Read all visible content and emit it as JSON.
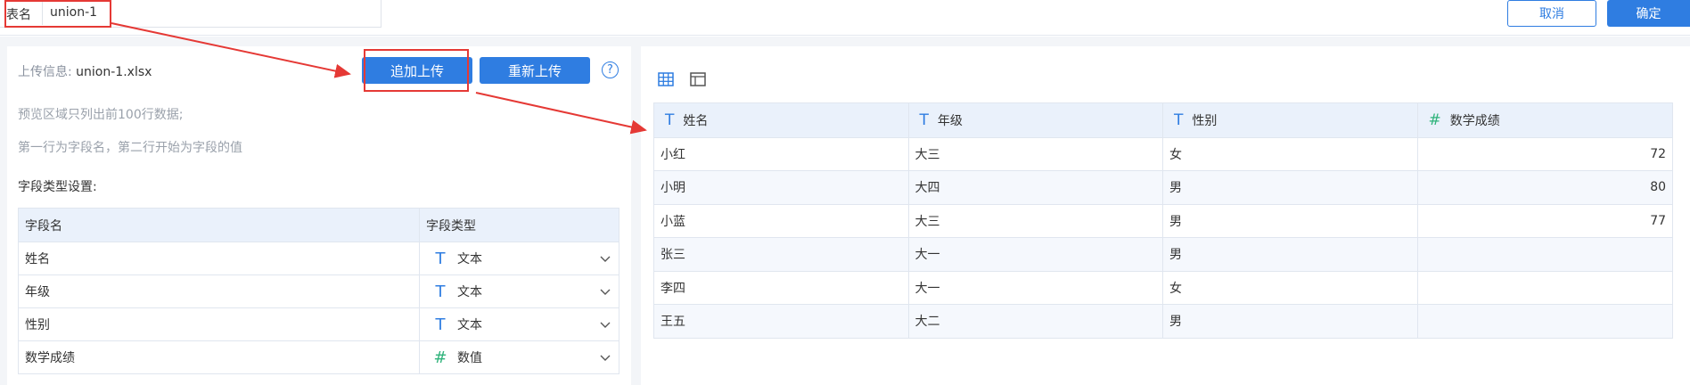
{
  "header": {
    "table_name_label": "表名",
    "table_name_value": "union-1",
    "cancel_label": "取消",
    "confirm_label": "确定"
  },
  "upload": {
    "info_label": "上传信息:",
    "file_name": "union-1.xlsx",
    "append_button": "追加上传",
    "reupload_button": "重新上传",
    "help_icon": "?",
    "hint_preview": "预览区域只列出前100行数据;",
    "hint_header": "第一行为字段名，第二行开始为字段的值"
  },
  "field_settings": {
    "title": "字段类型设置:",
    "col_name": "字段名",
    "col_type": "字段类型",
    "rows": [
      {
        "name": "姓名",
        "type": "文本",
        "type_icon": "text-type-icon"
      },
      {
        "name": "年级",
        "type": "文本",
        "type_icon": "text-type-icon"
      },
      {
        "name": "性别",
        "type": "文本",
        "type_icon": "text-type-icon"
      },
      {
        "name": "数学成绩",
        "type": "数值",
        "type_icon": "number-type-icon"
      }
    ]
  },
  "preview": {
    "columns": [
      {
        "label": "姓名",
        "icon": "T"
      },
      {
        "label": "年级",
        "icon": "T"
      },
      {
        "label": "性别",
        "icon": "T"
      },
      {
        "label": "数学成绩",
        "icon": "#"
      }
    ],
    "rows": [
      [
        "小红",
        "大三",
        "女",
        "72"
      ],
      [
        "小明",
        "大四",
        "男",
        "80"
      ],
      [
        "小蓝",
        "大三",
        "男",
        "77"
      ],
      [
        "张三",
        "大一",
        "男",
        ""
      ],
      [
        "李四",
        "大一",
        "女",
        ""
      ],
      [
        "王五",
        "大二",
        "男",
        ""
      ]
    ]
  },
  "colors": {
    "primary": "#2f7de1",
    "annotation": "#e53935",
    "number_icon": "#2fb37b",
    "header_bg": "#eaf1fb"
  }
}
